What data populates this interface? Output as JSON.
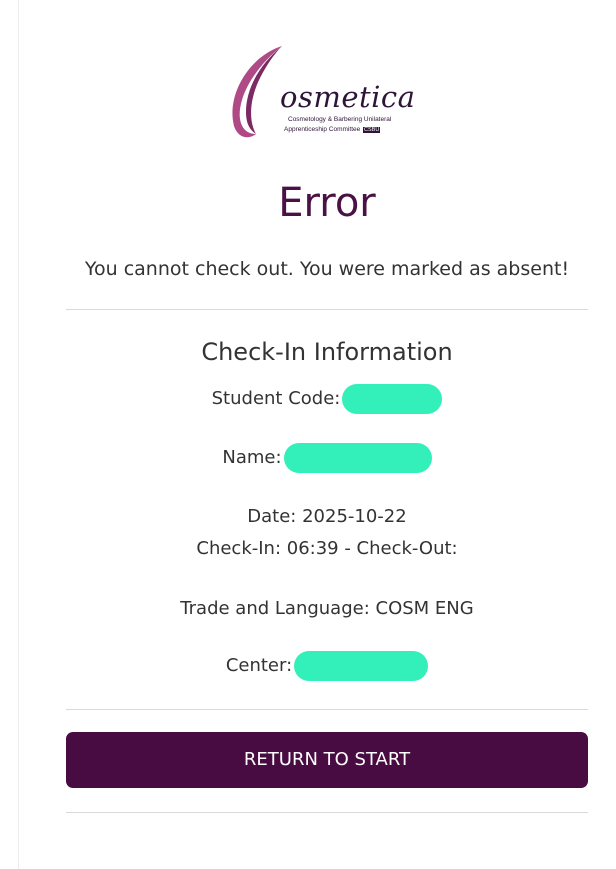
{
  "logo": {
    "wordmark": "osmetica",
    "subtitle_line1": "Cosmetology & Barbering Unilateral",
    "subtitle_line2": "Apprenticeship Committee",
    "badge": "CSBU"
  },
  "page": {
    "title": "Error",
    "message": "You cannot check out. You were marked as absent!"
  },
  "checkin": {
    "heading": "Check-In Information",
    "student_code_label": "Student Code:",
    "name_label": "Name:",
    "date_line": "Date: 2025-10-22",
    "time_line": "Check-In: 06:39 - Check-Out:",
    "trade_line": "Trade and Language: COSM ENG",
    "center_label": "Center:"
  },
  "actions": {
    "return_label": "RETURN TO START"
  },
  "colors": {
    "accent": "#490c42",
    "redaction": "#33f0ba"
  }
}
